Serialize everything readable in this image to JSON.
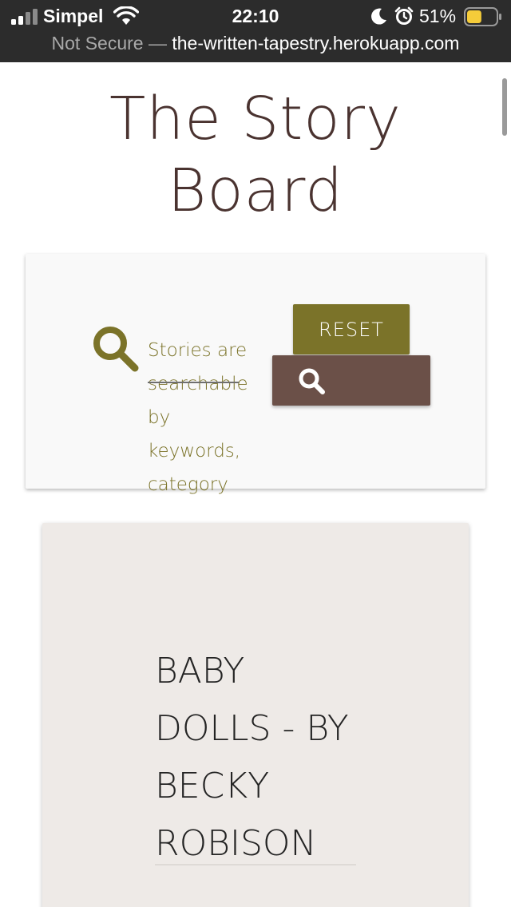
{
  "status_bar": {
    "carrier": "Simpel",
    "time": "22:10",
    "battery_percent": "51%",
    "battery_level": 0.51,
    "battery_color": "#f5cc3a",
    "icons": [
      "signal-icon",
      "wifi-icon",
      "moon-icon",
      "alarm-icon",
      "battery-icon"
    ]
  },
  "url_bar": {
    "security_label": "Not Secure",
    "separator": " — ",
    "domain": "the-written-tapestry.herokuapp.com"
  },
  "page": {
    "title": "The Story Board"
  },
  "search": {
    "hint_text": "Stories are searchable by keywords, category",
    "reset_label": "RESET",
    "icons": [
      "search-icon",
      "search-button-icon"
    ],
    "colors": {
      "accent_olive": "#7b7329",
      "accent_brown": "#6b5048",
      "title_brown": "#4a3330"
    }
  },
  "story": {
    "title": "BABY DOLLS - BY BECKY ROBISON"
  }
}
